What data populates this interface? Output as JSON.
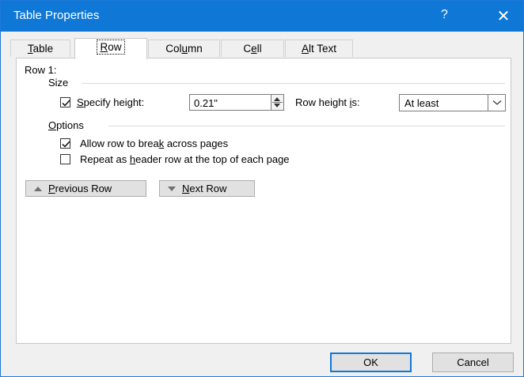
{
  "window": {
    "title": "Table Properties",
    "help_label": "?",
    "close_glyph": "✕"
  },
  "tabs": [
    {
      "pre": "",
      "u": "T",
      "post": "able",
      "selected": false
    },
    {
      "pre": "",
      "u": "R",
      "post": "ow",
      "selected": true
    },
    {
      "pre": "Col",
      "u": "u",
      "post": "mn",
      "selected": false
    },
    {
      "pre": "C",
      "u": "e",
      "post": "ll",
      "selected": false
    },
    {
      "pre": "",
      "u": "A",
      "post": "lt Text",
      "selected": false
    }
  ],
  "row_panel": {
    "heading": "Row 1:",
    "size_group": "Size",
    "specify_height": {
      "pre": "",
      "u": "S",
      "post": "pecify height:",
      "checked": true
    },
    "height_value": "0.21\"",
    "row_height_is": {
      "pre": "Row height ",
      "u": "i",
      "post": "s:"
    },
    "row_height_mode": "At least",
    "options_group": {
      "pre": "",
      "u": "O",
      "post": "ptions"
    },
    "allow_break": {
      "pre": "Allow row to brea",
      "u": "k",
      "post": " across pages",
      "checked": true
    },
    "repeat_header": {
      "pre": "Repeat as ",
      "u": "h",
      "post": "eader row at the top of each page",
      "checked": false
    },
    "previous_row": {
      "pre": "",
      "u": "P",
      "post": "revious Row"
    },
    "next_row": {
      "pre": "",
      "u": "N",
      "post": "ext Row"
    }
  },
  "buttons": {
    "ok": "OK",
    "cancel": "Cancel"
  },
  "colors": {
    "titlebar": "#0f78d7",
    "window_bg": "#f0f0f0",
    "panel_bg": "#ffffff",
    "default_button_border": "#0f78d7"
  }
}
